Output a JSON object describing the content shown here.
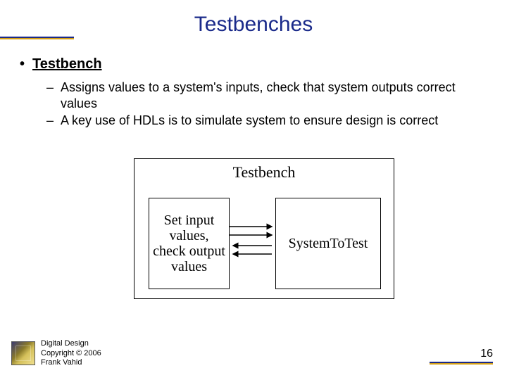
{
  "title": "Testbenches",
  "content": {
    "heading": "Testbench",
    "points": [
      "Assigns values to a system's inputs, check that system outputs correct values",
      "A key use of HDLs is to simulate system to ensure design is correct"
    ]
  },
  "diagram": {
    "title": "Testbench",
    "left_box": "Set input values, check output values",
    "right_box": "SystemToTest"
  },
  "footer": {
    "line1": "Digital Design",
    "line2": "Copyright © 2006",
    "line3": "Frank Vahid",
    "page": "16"
  }
}
